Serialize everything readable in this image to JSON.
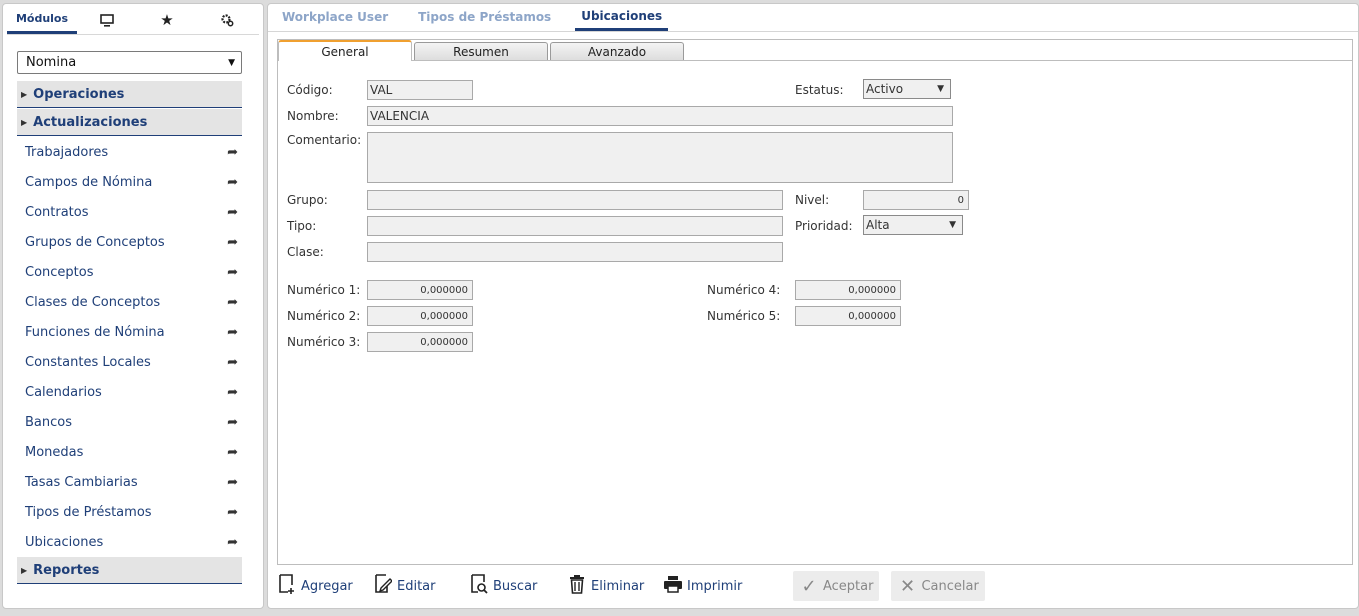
{
  "left": {
    "tabs": {
      "modules": "Módulos",
      "desktop_icon": "monitor-icon",
      "favorites_icon": "star-icon",
      "settings_icon": "gear-icon"
    },
    "module_select": "Nomina",
    "sections": {
      "operaciones": "Operaciones",
      "actualizaciones": "Actualizaciones",
      "reportes": "Reportes"
    },
    "nav_items": [
      "Trabajadores",
      "Campos de Nómina",
      "Contratos",
      "Grupos de Conceptos",
      "Conceptos",
      "Clases de Conceptos",
      "Funciones de Nómina",
      "Constantes Locales",
      "Calendarios",
      "Bancos",
      "Monedas",
      "Tasas Cambiarias",
      "Tipos de Préstamos",
      "Ubicaciones"
    ]
  },
  "top_tabs": [
    "Workplace User",
    "Tipos de Préstamos",
    "Ubicaciones"
  ],
  "sub_tabs": [
    "General",
    "Resumen",
    "Avanzado"
  ],
  "form": {
    "codigo_label": "Código:",
    "codigo_value": "VAL",
    "estatus_label": "Estatus:",
    "estatus_value": "Activo",
    "nombre_label": "Nombre:",
    "nombre_value": "VALENCIA",
    "comentario_label": "Comentario:",
    "comentario_value": "",
    "grupo_label": "Grupo:",
    "grupo_value": "",
    "nivel_label": "Nivel:",
    "nivel_value": "0",
    "tipo_label": "Tipo:",
    "tipo_value": "",
    "prioridad_label": "Prioridad:",
    "prioridad_value": "Alta",
    "clase_label": "Clase:",
    "clase_value": "",
    "num1_label": "Numérico 1:",
    "num1_value": "0,000000",
    "num2_label": "Numérico 2:",
    "num2_value": "0,000000",
    "num3_label": "Numérico 3:",
    "num3_value": "0,000000",
    "num4_label": "Numérico 4:",
    "num4_value": "0,000000",
    "num5_label": "Numérico 5:",
    "num5_value": "0,000000"
  },
  "toolbar": {
    "agregar": "Agregar",
    "editar": "Editar",
    "buscar": "Buscar",
    "eliminar": "Eliminar",
    "imprimir": "Imprimir",
    "aceptar": "Aceptar",
    "cancelar": "Cancelar"
  }
}
